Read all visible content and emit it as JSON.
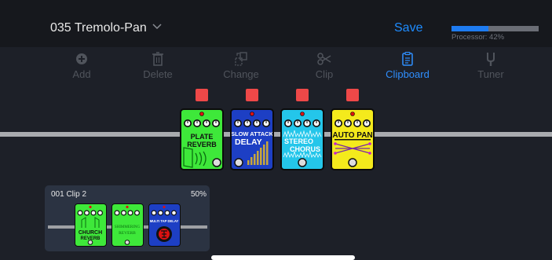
{
  "header": {
    "preset_name": "035 Tremolo-Pan",
    "save_label": "Save",
    "processor_label": "Processor: 42%",
    "processor_fraction": 0.42
  },
  "toolbar": {
    "items": [
      {
        "label": "Add",
        "icon": "plus-circle-icon",
        "active": false
      },
      {
        "label": "Delete",
        "icon": "trash-icon",
        "active": false
      },
      {
        "label": "Change",
        "icon": "change-icon",
        "active": false
      },
      {
        "label": "Clip",
        "icon": "scissors-icon",
        "active": false
      },
      {
        "label": "Clipboard",
        "icon": "clipboard-icon",
        "active": true
      },
      {
        "label": "Tuner",
        "icon": "tuner-fork-icon",
        "active": false
      }
    ]
  },
  "chain": {
    "pedals": [
      {
        "line1": "PLATE",
        "line2": "REVERB",
        "color": "#3ee83a",
        "enabled_color": "#ee4848"
      },
      {
        "line1": "SLOW ATTACK",
        "line2": "DELAY",
        "color": "#1d3fc4",
        "enabled_color": "#ee4848"
      },
      {
        "line1": "STEREO",
        "line2": "CHORUS",
        "color": "#24c6ea",
        "enabled_color": "#ee4848"
      },
      {
        "line1": "AUTO PAN",
        "line2": "",
        "color": "#f4ea1c",
        "enabled_color": "#ee4848"
      }
    ]
  },
  "clip": {
    "title": "001  Clip 2",
    "percent": "50%",
    "pedals": [
      {
        "line1": "CHURCH",
        "line2": "REVERB",
        "color": "#3ee83a"
      },
      {
        "line1": "SHIMMERING",
        "line2": "REVERB",
        "color": "#3ee83a"
      },
      {
        "line1": "MULTI TAP DELAY",
        "line2": "",
        "color": "#1d3fc4"
      }
    ]
  }
}
